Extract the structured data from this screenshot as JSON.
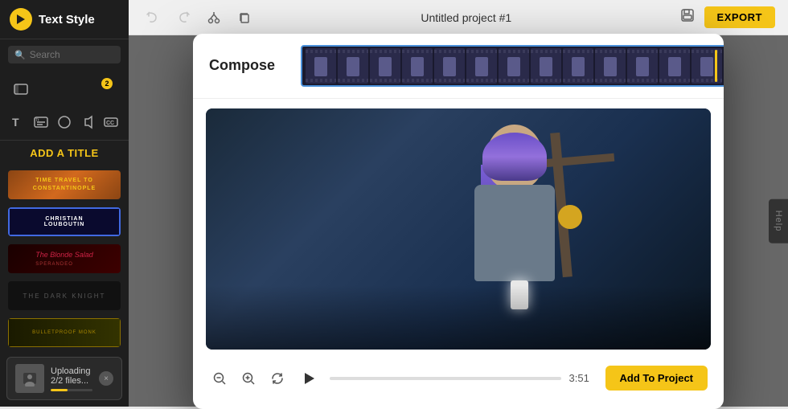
{
  "app": {
    "title": "Text Style",
    "logo": "▶",
    "project_name": "Untitled project #1"
  },
  "sidebar": {
    "search_placeholder": "Search",
    "nav_badge": "2",
    "add_title_label": "ADD A TITLE",
    "style_cards": [
      {
        "id": "style-1",
        "label": "TIME TRAVEL TO CONSTANTINOPLE",
        "type": "yellow"
      },
      {
        "id": "style-2",
        "label": "CHRISTIAN LOUBOUTIN",
        "type": "blue"
      },
      {
        "id": "style-3",
        "label": "The Blonde Salad",
        "type": "red"
      },
      {
        "id": "style-4",
        "label": "THE DARK KNIGHT",
        "type": "dark"
      },
      {
        "id": "style-5",
        "label": "BULLET PROOF MONK",
        "type": "gold"
      }
    ]
  },
  "topbar": {
    "undo_label": "↩",
    "redo_label": "↪",
    "cut_label": "✂",
    "copy_label": "⊞",
    "export_label": "EXPORT",
    "save_icon": "💾"
  },
  "modal": {
    "title": "Compose",
    "close_label": "×",
    "time_display": "3:51",
    "add_to_project_label": "Add To Project"
  },
  "upload": {
    "text": "Uploading 2/2 files...",
    "close_label": "×"
  },
  "help": {
    "label": "Help"
  }
}
